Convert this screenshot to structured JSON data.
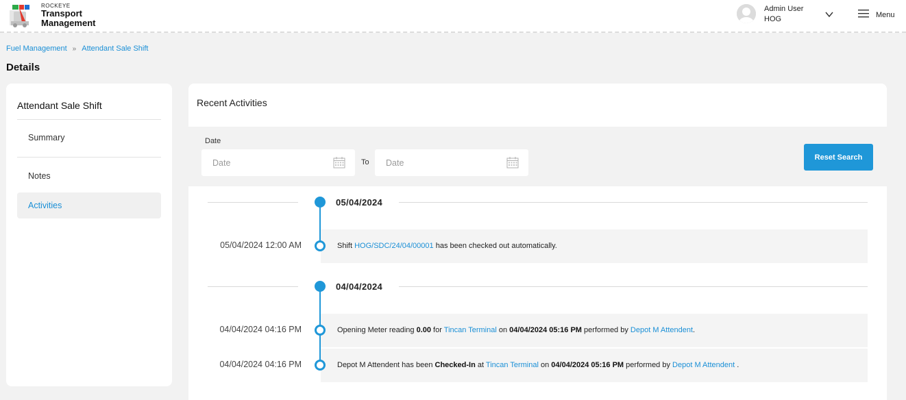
{
  "brand": {
    "small": "ROCKEYE",
    "line1": "Transport",
    "line2": "Management"
  },
  "user": {
    "name": "Admin User",
    "org": "HOG"
  },
  "menu": {
    "label": "Menu"
  },
  "breadcrumb": {
    "items": [
      "Fuel Management",
      "Attendant Sale Shift"
    ]
  },
  "page": {
    "title": "Details"
  },
  "left": {
    "title": "Attendant Sale Shift",
    "items": [
      "Summary",
      "Notes",
      "Activities"
    ],
    "active": "Activities"
  },
  "recent": {
    "title": "Recent Activities",
    "date_label": "Date",
    "from_placeholder": "Date",
    "to_label": "To",
    "to_placeholder": "Date",
    "reset_label": "Reset Search"
  },
  "timeline": {
    "group1": {
      "date": "05/04/2024",
      "entries": [
        {
          "time": "05/04/2024 12:00 AM",
          "t1": "Shift ",
          "l1": "HOG/SDC/24/04/00001",
          "t2": " has been checked out automatically."
        }
      ]
    },
    "group2": {
      "date": "04/04/2024",
      "entries": [
        {
          "time": "04/04/2024 04:16 PM",
          "t1": "Opening Meter reading ",
          "b1": "0.00",
          "t2": " for ",
          "l1": "Tincan Terminal",
          "t3": " on ",
          "b2": "04/04/2024 05:16 PM",
          "t4": " performed by ",
          "l2": "Depot M Attendent",
          "t5": "."
        },
        {
          "time": "04/04/2024 04:16 PM",
          "t1": "Depot M Attendent has been ",
          "b1": "Checked-In",
          "t2": " at ",
          "l1": "Tincan Terminal",
          "t3": " on ",
          "b2": "04/04/2024 05:16 PM",
          "t4": " performed by ",
          "l2": "Depot M Attendent",
          "t5": " ."
        }
      ]
    }
  },
  "colors": {
    "accent": "#1f97d8",
    "link": "#1a8fd6",
    "background": "#f2f2f2"
  }
}
